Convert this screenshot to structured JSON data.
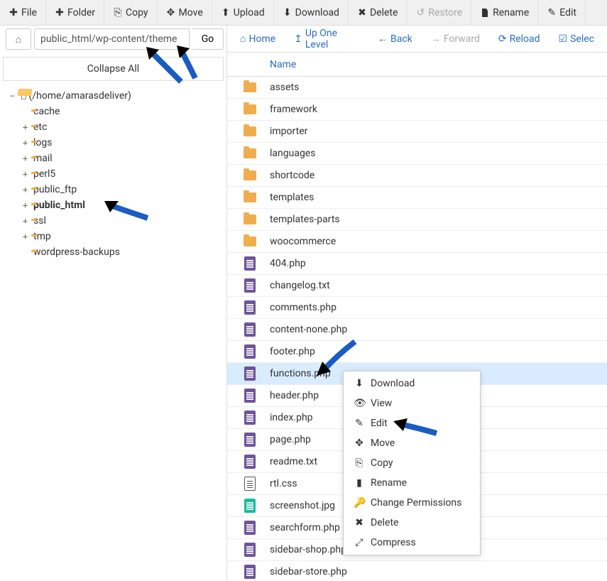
{
  "toolbar": {
    "file": "File",
    "folder": "Folder",
    "copy": "Copy",
    "move": "Move",
    "upload": "Upload",
    "download": "Download",
    "delete": "Delete",
    "restore": "Restore",
    "rename": "Rename",
    "edit": "Edit"
  },
  "path": {
    "value": "public_html/wp-content/theme",
    "go": "Go"
  },
  "collapse": "Collapse All",
  "tree": {
    "root": "(/home/amarasdeliver)",
    "items": [
      {
        "label": "cache",
        "expandable": false
      },
      {
        "label": "etc",
        "expandable": true
      },
      {
        "label": "logs",
        "expandable": true
      },
      {
        "label": "mail",
        "expandable": true
      },
      {
        "label": "perl5",
        "expandable": true
      },
      {
        "label": "public_ftp",
        "expandable": true
      },
      {
        "label": "public_html",
        "expandable": true,
        "bold": true
      },
      {
        "label": "ssl",
        "expandable": true
      },
      {
        "label": "tmp",
        "expandable": true
      },
      {
        "label": "wordpress-backups",
        "expandable": false
      }
    ]
  },
  "nav": {
    "home": "Home",
    "up": "Up One Level",
    "back": "Back",
    "forward": "Forward",
    "reload": "Reload",
    "select": "Selec"
  },
  "list": {
    "header_name": "Name"
  },
  "files": [
    {
      "name": "assets",
      "type": "folder"
    },
    {
      "name": "framework",
      "type": "folder"
    },
    {
      "name": "importer",
      "type": "folder"
    },
    {
      "name": "languages",
      "type": "folder"
    },
    {
      "name": "shortcode",
      "type": "folder"
    },
    {
      "name": "templates",
      "type": "folder"
    },
    {
      "name": "templates-parts",
      "type": "folder"
    },
    {
      "name": "woocommerce",
      "type": "folder"
    },
    {
      "name": "404.php",
      "type": "php"
    },
    {
      "name": "changelog.txt",
      "type": "php"
    },
    {
      "name": "comments.php",
      "type": "php"
    },
    {
      "name": "content-none.php",
      "type": "php"
    },
    {
      "name": "footer.php",
      "type": "php"
    },
    {
      "name": "functions.php",
      "type": "php",
      "selected": true
    },
    {
      "name": "header.php",
      "type": "php"
    },
    {
      "name": "index.php",
      "type": "php"
    },
    {
      "name": "page.php",
      "type": "php"
    },
    {
      "name": "readme.txt",
      "type": "php"
    },
    {
      "name": "rtl.css",
      "type": "css"
    },
    {
      "name": "screenshot.jpg",
      "type": "img"
    },
    {
      "name": "searchform.php",
      "type": "php"
    },
    {
      "name": "sidebar-shop.php",
      "type": "php"
    },
    {
      "name": "sidebar-store.php",
      "type": "php"
    }
  ],
  "context": {
    "download": "Download",
    "view": "View",
    "edit": "Edit",
    "move": "Move",
    "copy": "Copy",
    "rename": "Rename",
    "perms": "Change Permissions",
    "delete": "Delete",
    "compress": "Compress"
  }
}
